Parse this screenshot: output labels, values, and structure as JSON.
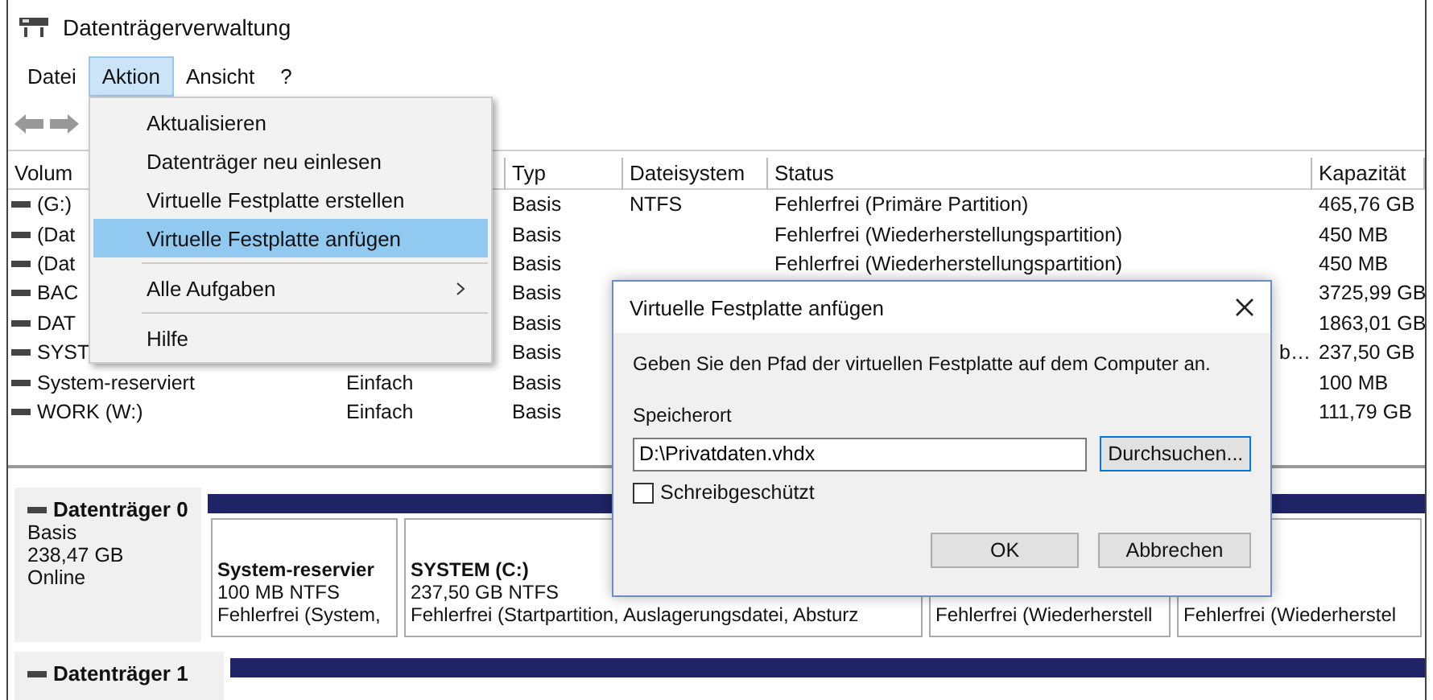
{
  "window": {
    "title": "Datenträgerverwaltung"
  },
  "menu_bar": [
    {
      "label": "Datei",
      "selected": false
    },
    {
      "label": "Aktion",
      "selected": true
    },
    {
      "label": "Ansicht",
      "selected": false
    },
    {
      "label": "?",
      "selected": false
    }
  ],
  "volume_table": {
    "columns": [
      "Volum",
      "",
      "Typ",
      "Dateisystem",
      "Status",
      "Kapazität"
    ],
    "rows": [
      {
        "volume": "(G:)",
        "type": "Basis",
        "filesystem": "NTFS",
        "status": "Fehlerfrei (Primäre Partition)",
        "capacity": "465,76 GB"
      },
      {
        "volume": "(Dat",
        "type": "Basis",
        "status": "Fehlerfrei (Wiederherstellungspartition)",
        "capacity": "450 MB"
      },
      {
        "volume": "(Dat",
        "type": "Basis",
        "status": "Fehlerfrei (Wiederherstellungspartition)",
        "capacity": "450 MB"
      },
      {
        "volume": "BAC",
        "type": "Basis",
        "capacity": "3725,99 GB"
      },
      {
        "volume": "DAT",
        "type": "Basis",
        "capacity": "1863,01 GB"
      },
      {
        "volume": "SYST",
        "type": "Basis",
        "status_end": "b…",
        "capacity": "237,50 GB"
      },
      {
        "volume": "System-reserviert",
        "layout": "Einfach",
        "type": "Basis",
        "capacity": "100 MB"
      },
      {
        "volume": "WORK (W:)",
        "layout": "Einfach",
        "type": "Basis",
        "capacity": "111,79 GB"
      }
    ]
  },
  "disks": [
    {
      "name": "Datenträger 0",
      "details": [
        "Basis",
        "238,47 GB",
        "Online"
      ],
      "partitions": [
        {
          "name": "System-reservier",
          "size": "100 MB NTFS",
          "status": "Fehlerfrei (System,"
        },
        {
          "name": "SYSTEM  (C:)",
          "size": "237,50 GB NTFS",
          "status": "Fehlerfrei (Startpartition, Auslagerungsdatei, Absturz"
        },
        {
          "status": "Fehlerfrei (Wiederherstell"
        },
        {
          "status": "Fehlerfrei (Wiederherstel"
        }
      ]
    },
    {
      "name": "Datenträger 1"
    }
  ],
  "action_menu": [
    {
      "kind": "item",
      "label": "Aktualisieren",
      "selected": false
    },
    {
      "kind": "item",
      "label": "Datenträger neu einlesen",
      "selected": false
    },
    {
      "kind": "item",
      "label": "Virtuelle Festplatte erstellen",
      "selected": false
    },
    {
      "kind": "item",
      "label": "Virtuelle Festplatte anfügen",
      "selected": true
    },
    {
      "kind": "separator"
    },
    {
      "kind": "submenu",
      "label": "Alle Aufgaben",
      "selected": false
    },
    {
      "kind": "separator"
    },
    {
      "kind": "item",
      "label": "Hilfe",
      "selected": false
    }
  ],
  "dialog": {
    "title": "Virtuelle Festplatte anfügen",
    "description": "Geben Sie den Pfad der virtuellen Festplatte auf dem Computer an.",
    "location_label": "Speicherort",
    "location_value": "D:\\Privatdaten.vhdx",
    "browse_button": "Durchsuchen...",
    "read_only": {
      "label": "Schreibgeschützt",
      "checked": false
    },
    "buttons": [
      "OK",
      "Abbrechen"
    ]
  }
}
